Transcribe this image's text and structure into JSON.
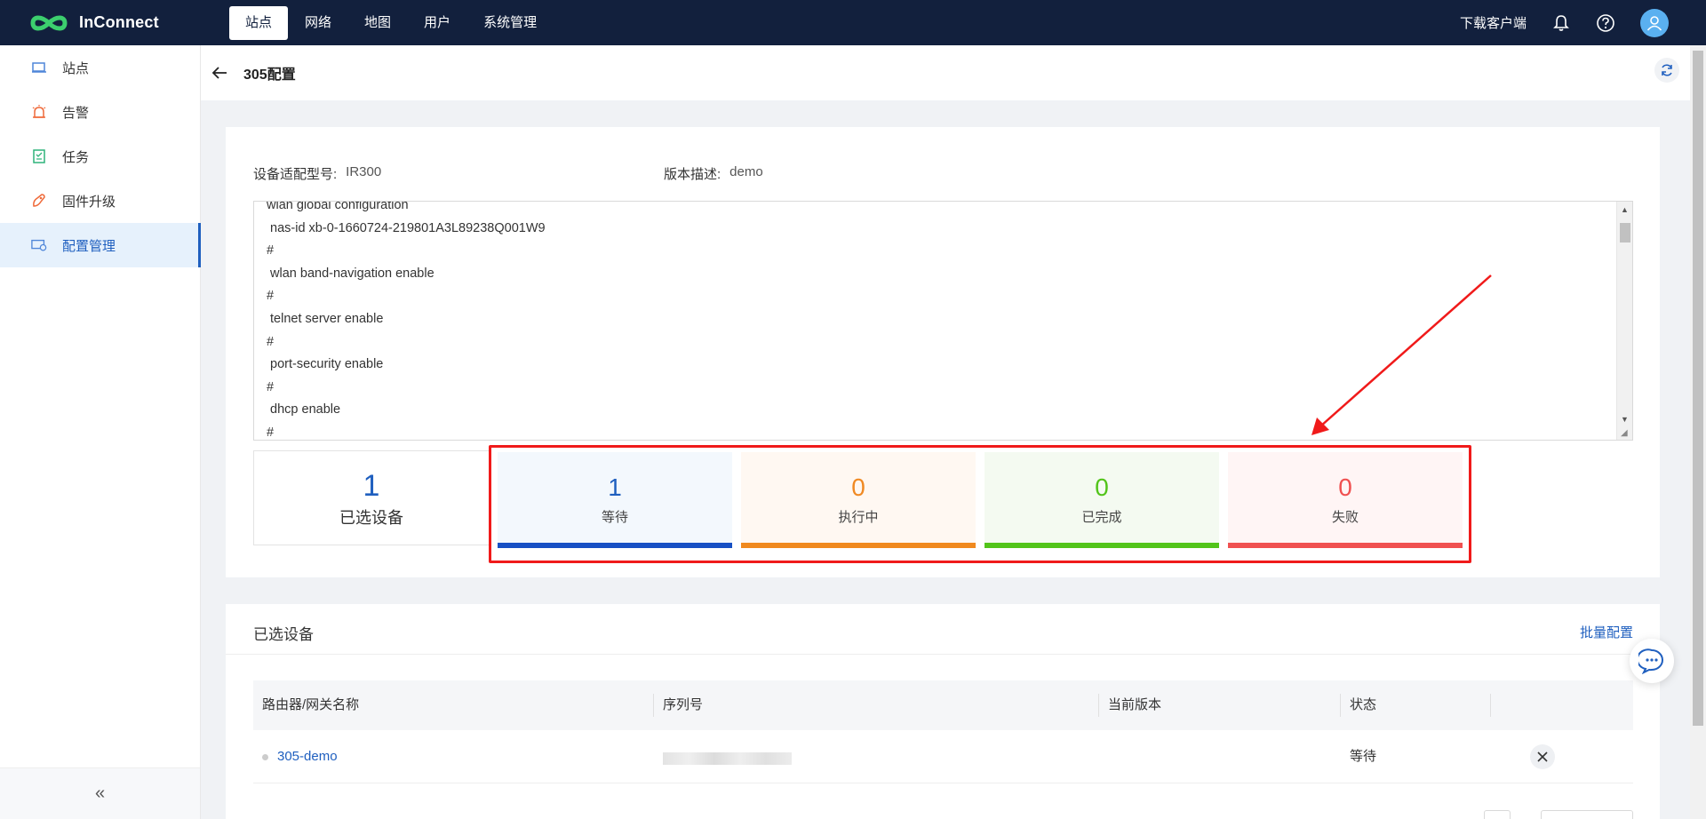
{
  "app": {
    "name": "InConnect",
    "brand_color": "#12203d",
    "accent_color": "#1f5fbf"
  },
  "topnav": {
    "items": [
      {
        "label": "站点",
        "active": true
      },
      {
        "label": "网络",
        "active": false
      },
      {
        "label": "地图",
        "active": false
      },
      {
        "label": "用户",
        "active": false
      },
      {
        "label": "系统管理",
        "active": false
      }
    ],
    "download_label": "下载客户端",
    "icons": [
      "bell-icon",
      "help-icon",
      "user-avatar-icon"
    ]
  },
  "sidebar": {
    "items": [
      {
        "label": "站点",
        "icon": "site-icon",
        "active": false
      },
      {
        "label": "告警",
        "icon": "alarm-icon",
        "active": false
      },
      {
        "label": "任务",
        "icon": "task-icon",
        "active": false
      },
      {
        "label": "固件升级",
        "icon": "firmware-icon",
        "active": false
      },
      {
        "label": "配置管理",
        "icon": "config-icon",
        "active": true
      }
    ],
    "collapse_label": "«"
  },
  "page": {
    "title": "305配置"
  },
  "config": {
    "model_key": "设备适配型号:",
    "model_value": "IR300",
    "desc_key": "版本描述:",
    "desc_value": "demo",
    "lines": [
      "wlan global configuration",
      " nas-id xb-0-1660724-219801A3L89238Q001W9",
      "#",
      " wlan band-navigation enable",
      "#",
      " telnet server enable",
      "#",
      " port-security enable",
      "#",
      " dhcp enable",
      "#"
    ]
  },
  "selected": {
    "count": "1",
    "label": "已选设备"
  },
  "stats": [
    {
      "count": "1",
      "label": "等待",
      "color": "#1750c4",
      "bg": "#f3f8fd",
      "num_color": "#1f5fbf"
    },
    {
      "count": "0",
      "label": "执行中",
      "color": "#f0891e",
      "bg": "#fff8f2",
      "num_color": "#f08a24"
    },
    {
      "count": "0",
      "label": "已完成",
      "color": "#52c41a",
      "bg": "#f4faf1",
      "num_color": "#52c41a"
    },
    {
      "count": "0",
      "label": "失败",
      "color": "#f05050",
      "bg": "#fff5f5",
      "num_color": "#f05050"
    }
  ],
  "devices": {
    "title": "已选设备",
    "batch_label": "批量配置",
    "columns": [
      "路由器/网关名称",
      "序列号",
      "当前版本",
      "状态"
    ],
    "rows": [
      {
        "name": "305-demo",
        "serial": "",
        "version": "",
        "status": "等待"
      }
    ]
  }
}
